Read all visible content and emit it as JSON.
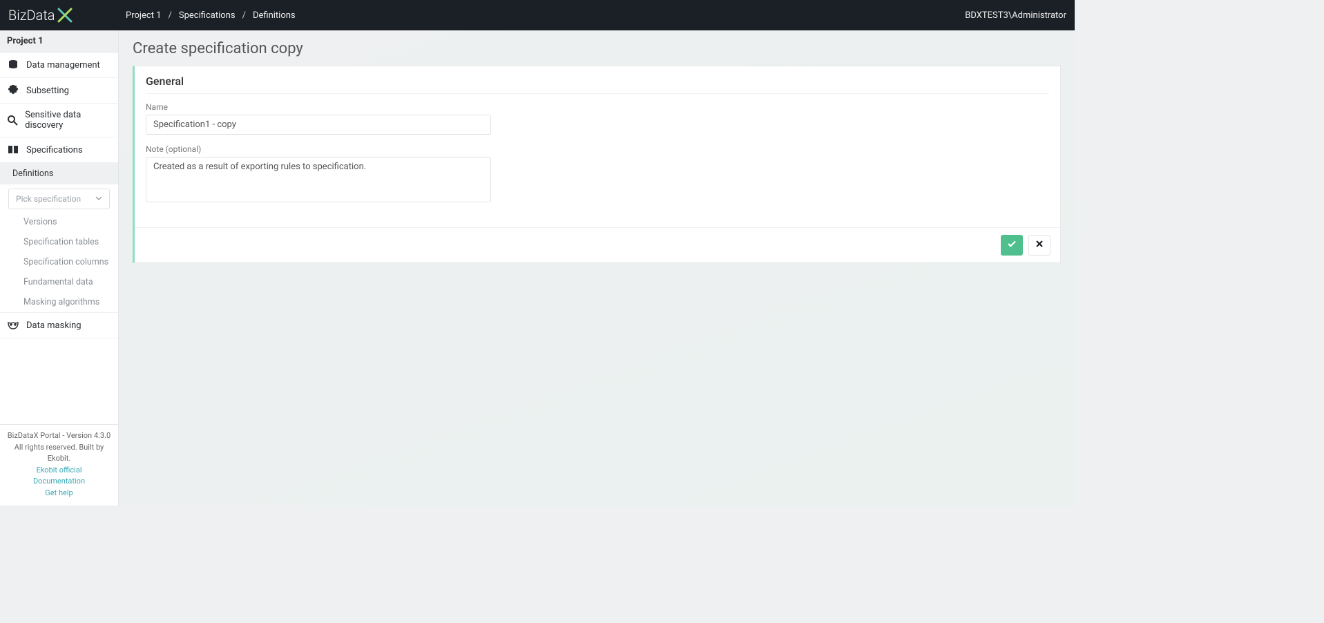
{
  "logo": {
    "text": "BizData"
  },
  "breadcrumb": {
    "items": [
      "Project 1",
      "Specifications",
      "Definitions"
    ]
  },
  "user": "BDXTEST3\\Administrator",
  "sidebar": {
    "project": "Project 1",
    "items": {
      "data_management": "Data management",
      "subsetting": "Subsetting",
      "sensitive": "Sensitive data discovery",
      "specifications": "Specifications",
      "definitions": "Definitions",
      "picker_placeholder": "Pick specification",
      "versions": "Versions",
      "spec_tables": "Specification tables",
      "spec_columns": "Specification columns",
      "fundamental": "Fundamental data",
      "masking_alg": "Masking algorithms",
      "data_masking": "Data masking"
    },
    "footer": {
      "line1": "BizDataX Portal - Version 4.3.0",
      "line2": "All rights reserved. Built by Ekobit.",
      "link1": "Ekobit official",
      "link2": "Documentation",
      "link3": "Get help"
    }
  },
  "page": {
    "title": "Create specification copy",
    "section": "General",
    "name_label": "Name",
    "name_value": "Specification1 - copy",
    "note_label": "Note (optional)",
    "note_value": "Created as a result of exporting rules to specification."
  }
}
